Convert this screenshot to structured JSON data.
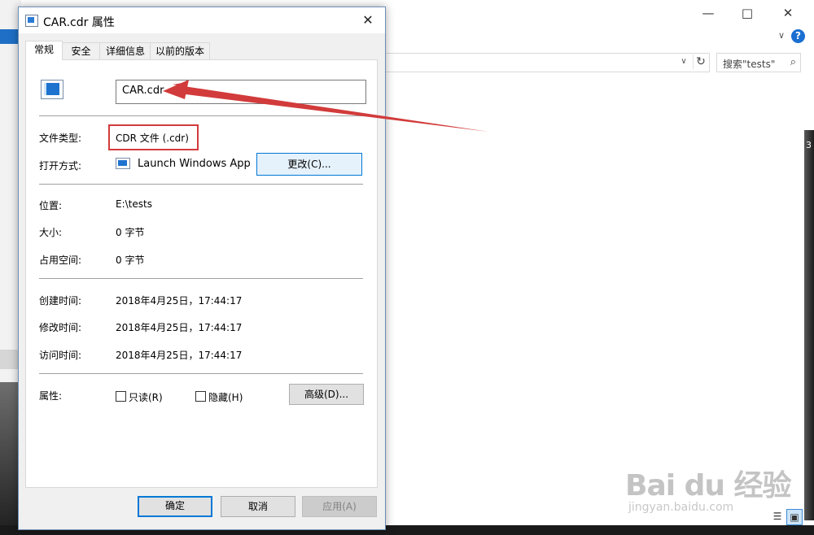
{
  "background": {
    "search_placeholder": "搜索\"tests\"",
    "right_number": "3",
    "watermark_brand": "Bai du 经验",
    "watermark_url": "jingyan.baidu.com"
  },
  "dialog": {
    "title": "CAR.cdr 属性",
    "tabs": [
      {
        "label": "常规",
        "active": true
      },
      {
        "label": "安全",
        "active": false
      },
      {
        "label": "详细信息",
        "active": false
      },
      {
        "label": "以前的版本",
        "active": false
      }
    ],
    "general": {
      "file_name": "CAR.cdr",
      "type_label": "文件类型:",
      "type_value": "CDR 文件 (.cdr)",
      "open_with_label": "打开方式:",
      "open_with_value": "Launch Windows App",
      "change_button": "更改(C)...",
      "location_label": "位置:",
      "location_value": "E:\\tests",
      "size_label": "大小:",
      "size_value": "0 字节",
      "size_on_disk_label": "占用空间:",
      "size_on_disk_value": "0 字节",
      "created_label": "创建时间:",
      "created_value": "2018年4月25日，17:44:17",
      "modified_label": "修改时间:",
      "modified_value": "2018年4月25日，17:44:17",
      "accessed_label": "访问时间:",
      "accessed_value": "2018年4月25日，17:44:17",
      "attributes_label": "属性:",
      "readonly_label": "只读(R)",
      "hidden_label": "隐藏(H)",
      "advanced_button": "高级(D)..."
    },
    "buttons": {
      "ok": "确定",
      "cancel": "取消",
      "apply": "应用(A)"
    }
  },
  "colors": {
    "highlight_red": "#d23b3b",
    "accent_blue": "#0078d7"
  }
}
